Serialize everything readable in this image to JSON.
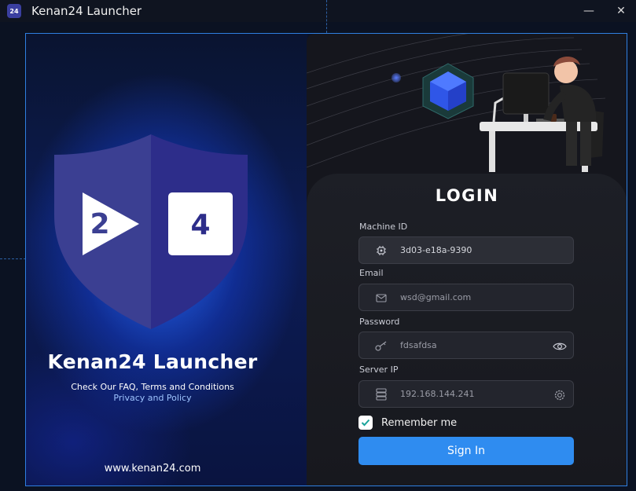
{
  "window": {
    "title": "Kenan24 Launcher",
    "icon_label": "24",
    "minimize_label": "—",
    "close_label": "✕"
  },
  "brand": {
    "shield_left": "2",
    "shield_right": "4",
    "title": "Kenan24 Launcher",
    "subtitle_line1": "Check Our FAQ, Terms and Conditions",
    "subtitle_line2": "Privacy and Policy",
    "website": "www.kenan24.com"
  },
  "login": {
    "title": "LOGIN",
    "machine_id": {
      "label": "Machine ID",
      "value": "3d03-e18a-9390",
      "icon": "chip-icon"
    },
    "email": {
      "label": "Email",
      "placeholder": "wsd@gmail.com",
      "icon": "mail-icon"
    },
    "password": {
      "label": "Password",
      "placeholder": "fdsafdsa",
      "icon": "key-icon",
      "toggle_icon": "eye-icon"
    },
    "server_ip": {
      "label": "Server IP",
      "placeholder": "192.168.144.241",
      "icon": "server-icon",
      "settings_icon": "gear-icon"
    },
    "remember_me": {
      "label": "Remember me",
      "checked": true
    },
    "sign_in_label": "Sign In"
  },
  "colors": {
    "accent": "#2f8cf0",
    "frame_border": "#2f7fe0",
    "checkbox_check": "#1aa39a"
  }
}
